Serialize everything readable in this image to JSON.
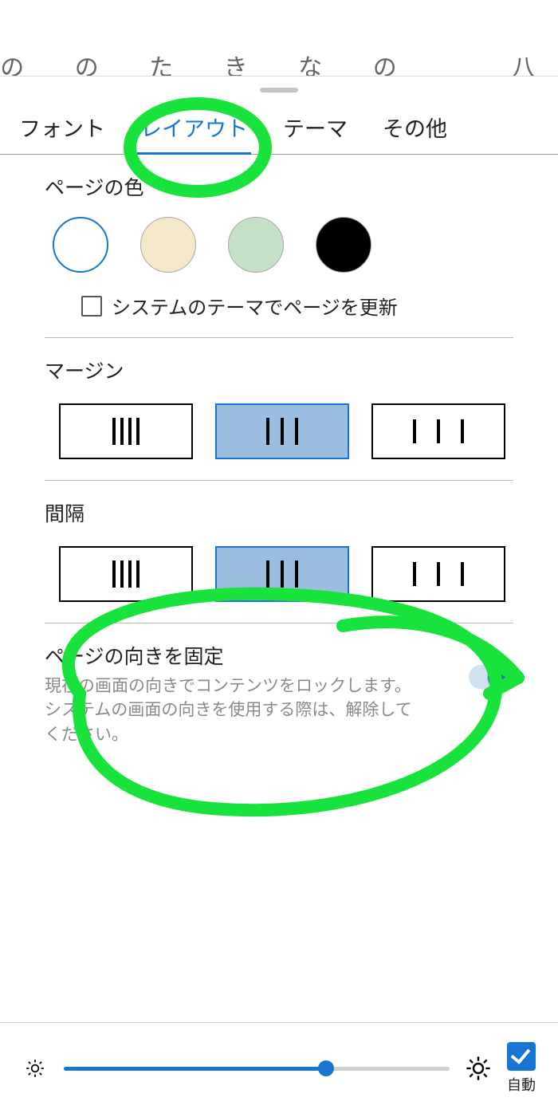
{
  "book_bg_text": "の の た き な の　　八",
  "tabs": [
    {
      "label": "フォント",
      "active": false
    },
    {
      "label": "レイアウト",
      "active": true
    },
    {
      "label": "テーマ",
      "active": false
    },
    {
      "label": "その他",
      "active": false
    }
  ],
  "page_color": {
    "title": "ページの色",
    "swatches": [
      {
        "color": "#ffffff",
        "selected": true
      },
      {
        "color": "#f5e8c8",
        "selected": false
      },
      {
        "color": "#c4e0c7",
        "selected": false
      },
      {
        "color": "#000000",
        "selected": false
      }
    ],
    "system_theme_checkbox_label": "システムのテーマでページを更新",
    "system_theme_checked": false
  },
  "margin": {
    "title": "マージン",
    "selected_index": 1
  },
  "spacing": {
    "title": "間隔",
    "selected_index": 1
  },
  "lock_orientation": {
    "title": "ページの向きを固定",
    "desc": "現在の画面の向きでコンテンツをロックします。システムの画面の向きを使用する際は、解除してください。",
    "enabled": true
  },
  "brightness": {
    "value_pct": 68,
    "auto_label": "自動",
    "auto_checked": true
  },
  "annotation_color": "#18e23c"
}
